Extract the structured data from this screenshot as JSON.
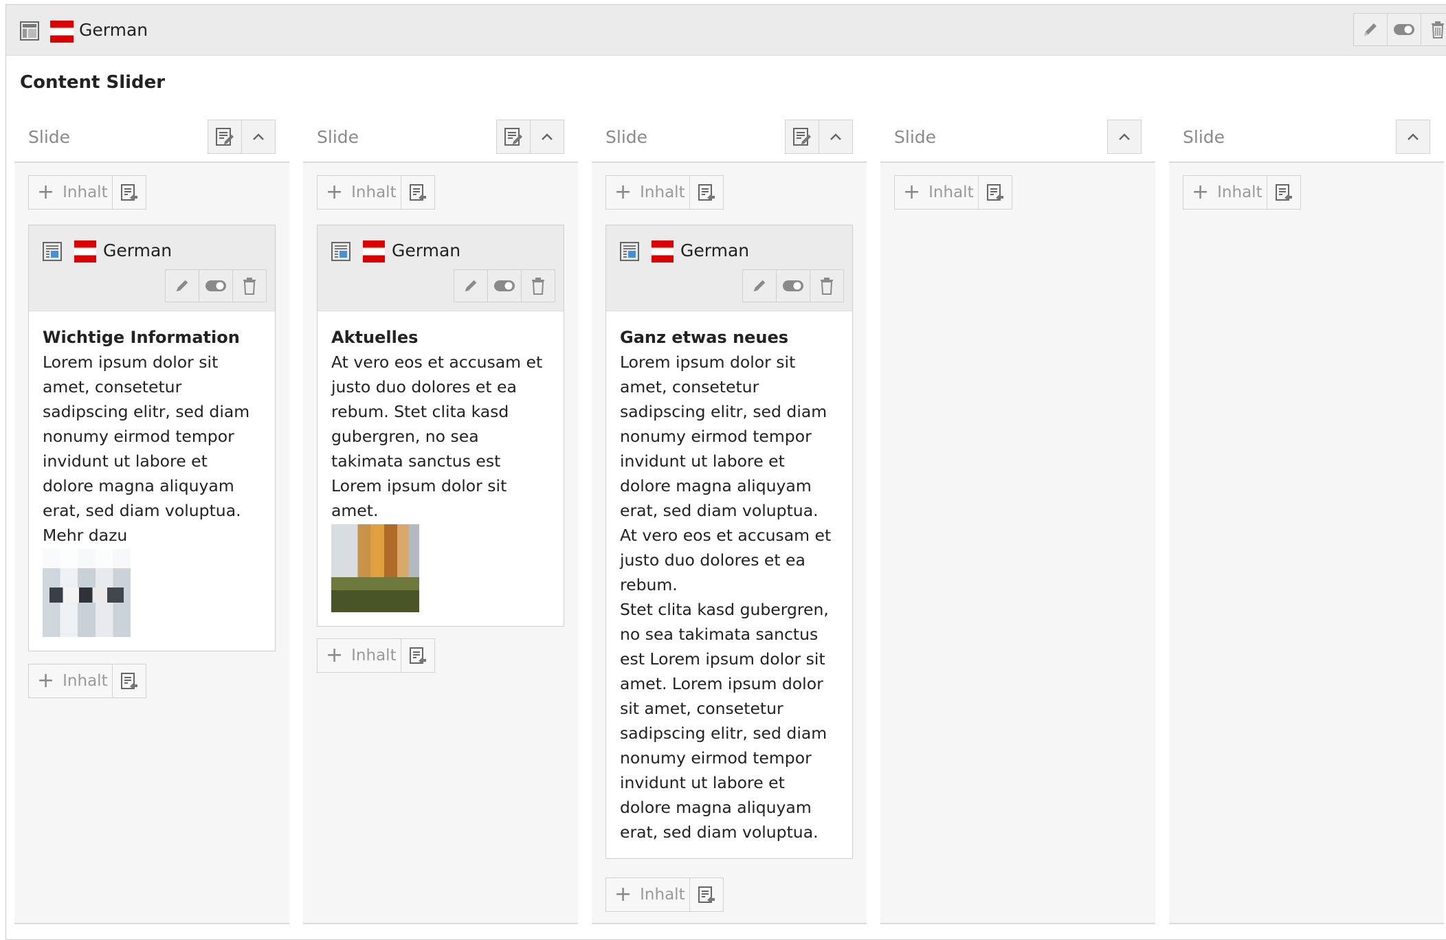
{
  "header": {
    "language": "German",
    "actions": [
      "edit",
      "toggle-visibility",
      "delete"
    ]
  },
  "content_title": "Content Slider",
  "columns": [
    {
      "title": "Slide",
      "has_edit": true,
      "add_label": "Inhalt",
      "card": {
        "language": "German",
        "heading": "Wichtige Information",
        "text": "Lorem ipsum dolor sit amet, consetetur sadipscing elitr, sed diam nonumy eirmod tempor invidunt ut labore et dolore magna aliquyam erat, sed diam voluptua. Mehr dazu",
        "image": "office photo"
      }
    },
    {
      "title": "Slide",
      "has_edit": true,
      "add_label": "Inhalt",
      "card": {
        "language": "German",
        "heading": "Aktuelles",
        "text": "At vero eos et accusam et justo duo dolores et ea rebum. Stet clita kasd gubergren, no sea takimata sanctus est Lorem ipsum dolor sit amet.",
        "image": "building photo"
      }
    },
    {
      "title": "Slide",
      "has_edit": true,
      "add_label": "Inhalt",
      "card": {
        "language": "German",
        "heading": "Ganz etwas neues",
        "text": "Lorem ipsum dolor sit amet, consetetur sadipscing elitr, sed diam nonumy eirmod tempor invidunt ut labore et dolore magna aliquyam erat, sed diam voluptua. At vero eos et accusam et justo duo dolores et ea rebum.",
        "text2": "Stet clita kasd gubergren, no sea takimata sanctus est Lorem ipsum dolor sit amet. Lorem ipsum dolor sit amet, consetetur sadipscing elitr, sed diam nonumy eirmod tempor invidunt ut labore et dolore magna aliquyam erat, sed diam voluptua."
      }
    },
    {
      "title": "Slide",
      "has_edit": false,
      "add_label": "Inhalt"
    },
    {
      "title": "Slide",
      "has_edit": false,
      "add_label": "Inhalt"
    }
  ],
  "colors": {
    "flag_red": "#dd0000",
    "header_bg": "#ebebeb",
    "column_bg": "#f6f6f6",
    "muted_text": "#8a8a8a"
  }
}
